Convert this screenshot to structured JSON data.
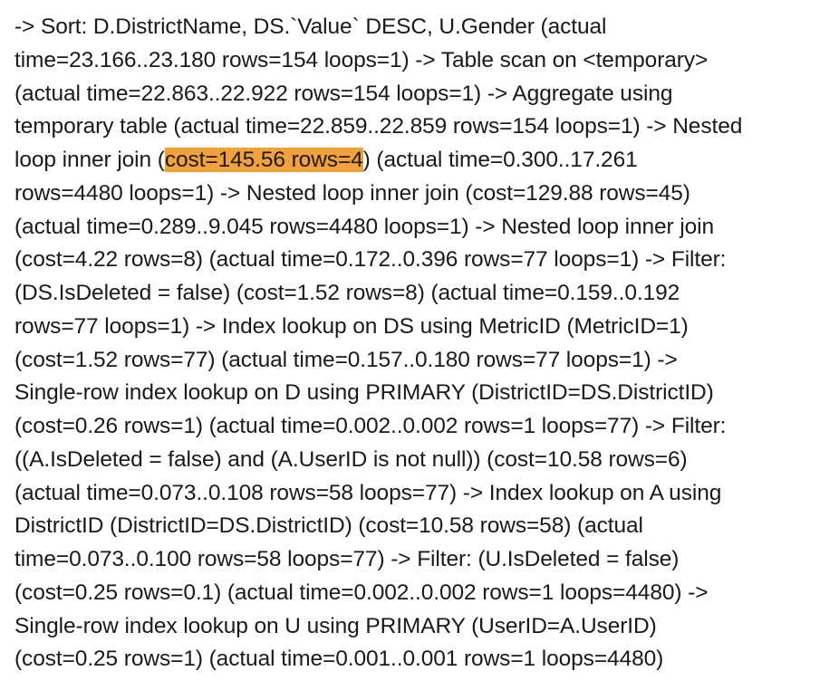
{
  "document": {
    "highlight_color": "#f3a13a",
    "lines": [
      {
        "text": "-> Sort: D.DistrictName, DS.`Value` DESC, U.Gender (actual"
      },
      {
        "text": "time=23.166..23.180 rows=154 loops=1) -> Table scan on <temporary>"
      },
      {
        "text": "(actual time=22.863..22.922 rows=154 loops=1) -> Aggregate using"
      },
      {
        "text": "temporary table (actual time=22.859..22.859 rows=154 loops=1) -> Nested"
      },
      {
        "before": "loop inner join (",
        "highlight": "cost=145.56 rows=4",
        "after": ") (actual time=0.300..17.261"
      },
      {
        "text": "rows=4480 loops=1) -> Nested loop inner join (cost=129.88 rows=45)"
      },
      {
        "text": "(actual time=0.289..9.045 rows=4480 loops=1) -> Nested loop inner join"
      },
      {
        "text": "(cost=4.22 rows=8) (actual time=0.172..0.396 rows=77 loops=1) -> Filter:"
      },
      {
        "text": "(DS.IsDeleted = false) (cost=1.52 rows=8) (actual time=0.159..0.192"
      },
      {
        "text": "rows=77 loops=1) -> Index lookup on DS using MetricID (MetricID=1)"
      },
      {
        "text": "(cost=1.52 rows=77) (actual time=0.157..0.180 rows=77 loops=1) ->"
      },
      {
        "text": "Single-row index lookup on D using PRIMARY (DistrictID=DS.DistrictID)"
      },
      {
        "text": "(cost=0.26 rows=1) (actual time=0.002..0.002 rows=1 loops=77) -> Filter:"
      },
      {
        "text": "((A.IsDeleted = false) and (A.UserID is not null)) (cost=10.58 rows=6)"
      },
      {
        "text": "(actual time=0.073..0.108 rows=58 loops=77) -> Index lookup on A using"
      },
      {
        "text": "DistrictID (DistrictID=DS.DistrictID) (cost=10.58 rows=58) (actual"
      },
      {
        "text": "time=0.073..0.100 rows=58 loops=77) -> Filter: (U.IsDeleted = false)"
      },
      {
        "text": "(cost=0.25 rows=0.1) (actual time=0.002..0.002 rows=1 loops=4480) ->"
      },
      {
        "text": "Single-row index lookup on U using PRIMARY (UserID=A.UserID)"
      },
      {
        "text": "(cost=0.25 rows=1) (actual time=0.001..0.001 rows=1 loops=4480)"
      }
    ]
  }
}
